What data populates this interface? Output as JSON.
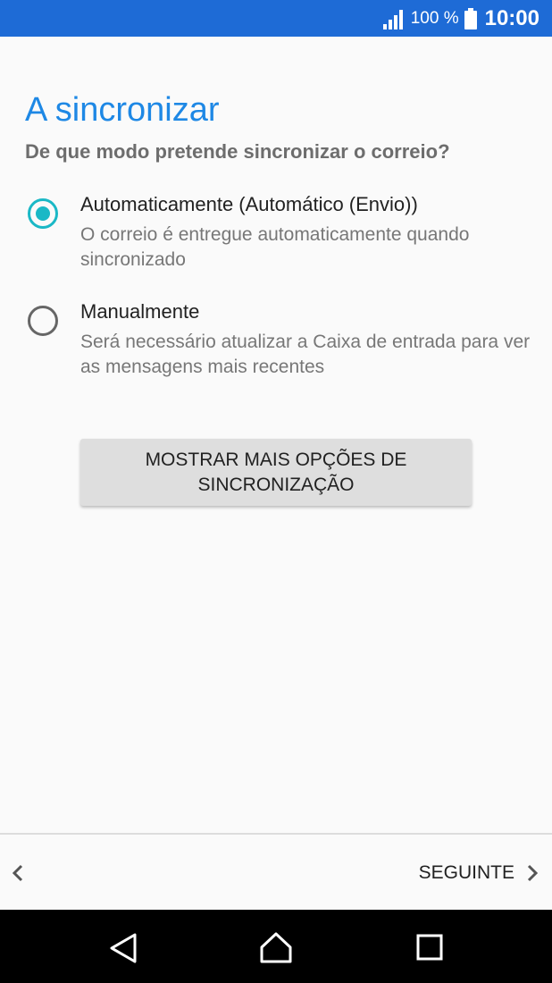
{
  "status_bar": {
    "battery_percent": "100 %",
    "time": "10:00",
    "signal_icon": "signal-icon",
    "battery_icon": "battery-icon",
    "background_color": "#1e6bd6"
  },
  "header": {
    "title": "A sincronizar",
    "subtitle": "De que modo pretende sincronizar o correio?"
  },
  "sync_options": [
    {
      "title": "Automaticamente (Automático (Envio))",
      "description": "O correio é entregue automaticamente quando sincronizado",
      "selected": true
    },
    {
      "title": "Manualmente",
      "description": "Será necessário atualizar a Caixa de entrada para ver as mensagens mais recentes",
      "selected": false
    }
  ],
  "more_options_button": {
    "label": "MOSTRAR MAIS OPÇÕES DE SINCRONIZAÇÃO"
  },
  "bottom_bar": {
    "back_icon": "chevron-left-icon",
    "next_label": "SEGUINTE",
    "next_icon": "chevron-right-icon"
  },
  "nav_bar": {
    "back_icon": "back-triangle-icon",
    "home_icon": "home-icon",
    "recents_icon": "recents-square-icon"
  },
  "colors": {
    "accent": "#1e88e5",
    "radio_selected": "#1ab8c6"
  }
}
